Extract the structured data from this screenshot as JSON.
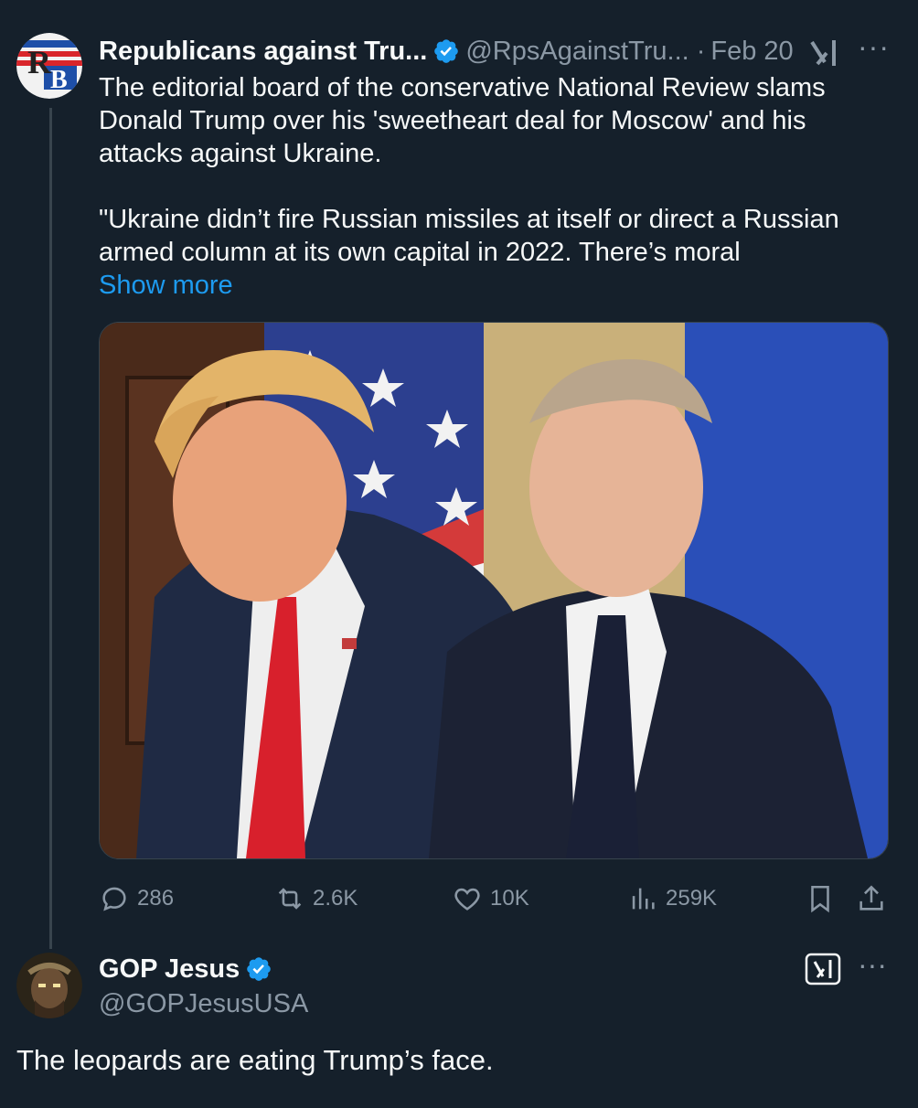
{
  "tweet": {
    "author_name": "Republicans against Tru...",
    "handle": "@RpsAgainstTru...",
    "separator": "·",
    "date": "Feb 20",
    "more_label": "···",
    "text_lines": [
      "The editorial board of the conservative National Review slams",
      "Donald Trump over his 'sweetheart deal for Moscow' and his",
      "attacks against Ukraine.",
      "\"Ukraine didn’t fire Russian missiles at itself or direct a Russian",
      "armed column at its own capital in 2022. There’s moral"
    ],
    "show_more": "Show more",
    "media_subject": "photo-two-men-suits-flags",
    "metrics": {
      "replies": "286",
      "reposts": "2.6K",
      "likes": "10K",
      "views": "259K"
    }
  },
  "reply": {
    "author_name": "GOP Jesus",
    "handle": "@GOPJesusUSA",
    "more_label": "···",
    "text": "The leopards are eating Trump’s face."
  },
  "colors": {
    "background": "#15202b",
    "text": "#f7f9f9",
    "muted": "#8b98a5",
    "link": "#1d9bf0",
    "verified": "#1d9bf0"
  }
}
